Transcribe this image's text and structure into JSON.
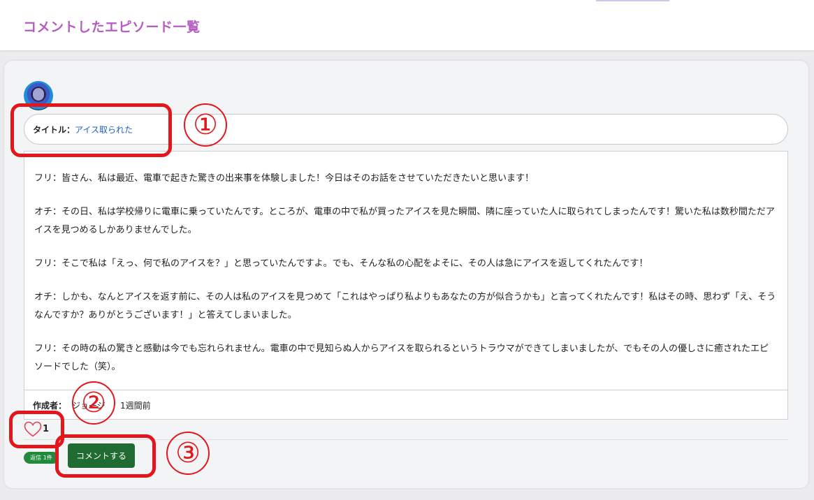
{
  "header": {
    "title": "コメントしたエピソード一覧"
  },
  "episode": {
    "title_label": "タイトル：",
    "title_value": "アイス取られた",
    "paragraphs": [
      "フリ：皆さん、私は最近、電車で起きた驚きの出来事を体験しました！今日はそのお話をさせていただきたいと思います！",
      "オチ：その日、私は学校帰りに電車に乗っていたんです。ところが、電車の中で私が買ったアイスを見た瞬間、隣に座っていた人に取られてしまったんです！驚いた私は数秒間ただアイスを見つめるしかありませんでした。",
      "フリ：そこで私は「えっ、何で私のアイスを？」と思っていたんですよ。でも、そんな私の心配をよそに、その人は急にアイスを返してくれたんです！",
      "オチ：しかも、なんとアイスを返す前に、その人は私のアイスを見つめて「これはやっぱり私よりもあなたの方が似合うかも」と言ってくれたんです！私はその時、思わず「え、そうなんですか？ありがとうございます！」と答えてしまいました。",
      "フリ：その時の私の驚きと感動は今でも忘れられません。電車の中で見知らぬ人からアイスを取られるというトラウマができてしまいましたが、でもその人の優しさに癒されたエピソードでした（笑）。"
    ],
    "author_label": "作成者：",
    "author_name": "ジョージ",
    "posted_time": "1週間前",
    "like_count": "1",
    "reply_badge": "返信 1件",
    "comment_button": "コメントする"
  },
  "annotations": {
    "one": "①",
    "two": "②",
    "three": "③",
    "color": "#e3161c"
  },
  "colors": {
    "title": "#b85cc4",
    "link": "#1f5fbf",
    "button": "#1f6b32",
    "badge": "#1f8a3a"
  }
}
